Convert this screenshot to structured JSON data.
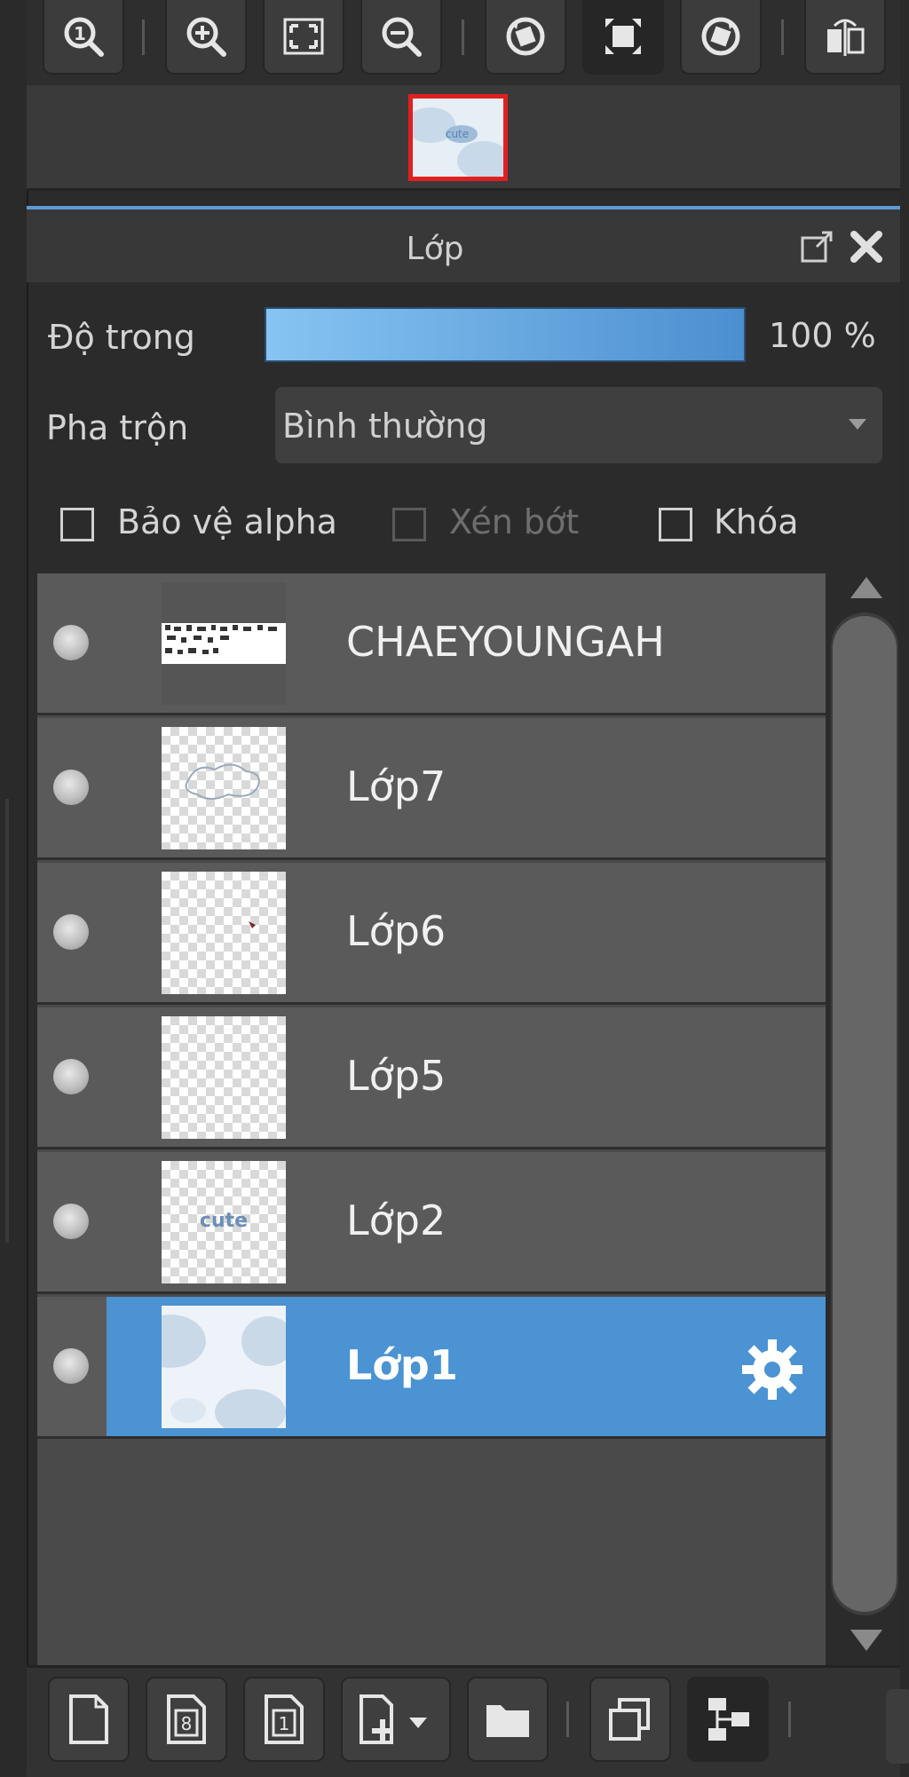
{
  "panel": {
    "title": "Lớp"
  },
  "opacity": {
    "label": "Độ trong",
    "value": "100 %",
    "level_percent": 100
  },
  "blend": {
    "label": "Pha trộn",
    "selected": "Bình thường"
  },
  "checkboxes": {
    "protect_alpha": "Bảo vệ alpha",
    "clipping": "Xén bớt",
    "lock": "Khóa"
  },
  "layers": [
    {
      "name": "CHAEYOUNGAH",
      "selected": false
    },
    {
      "name": "Lớp7",
      "selected": false
    },
    {
      "name": "Lớp6",
      "selected": false
    },
    {
      "name": "Lớp5",
      "selected": false
    },
    {
      "name": "Lớp2",
      "selected": false
    },
    {
      "name": "Lớp1",
      "selected": true
    }
  ],
  "toolbar_icons": [
    "zoom-actual-icon",
    "zoom-in-icon",
    "fit-screen-icon",
    "zoom-out-icon",
    "rotate-left-icon",
    "fullscreen-icon",
    "rotate-right-icon",
    "flip-icon"
  ],
  "bottom_icons": [
    "new-layer-icon",
    "new-8bit-layer-icon",
    "new-1bit-layer-icon",
    "add-layer-menu-icon",
    "new-folder-icon",
    "duplicate-layer-icon",
    "layer-structure-icon"
  ],
  "colors": {
    "accent": "#4b93d3",
    "selection_border": "#e02020"
  }
}
